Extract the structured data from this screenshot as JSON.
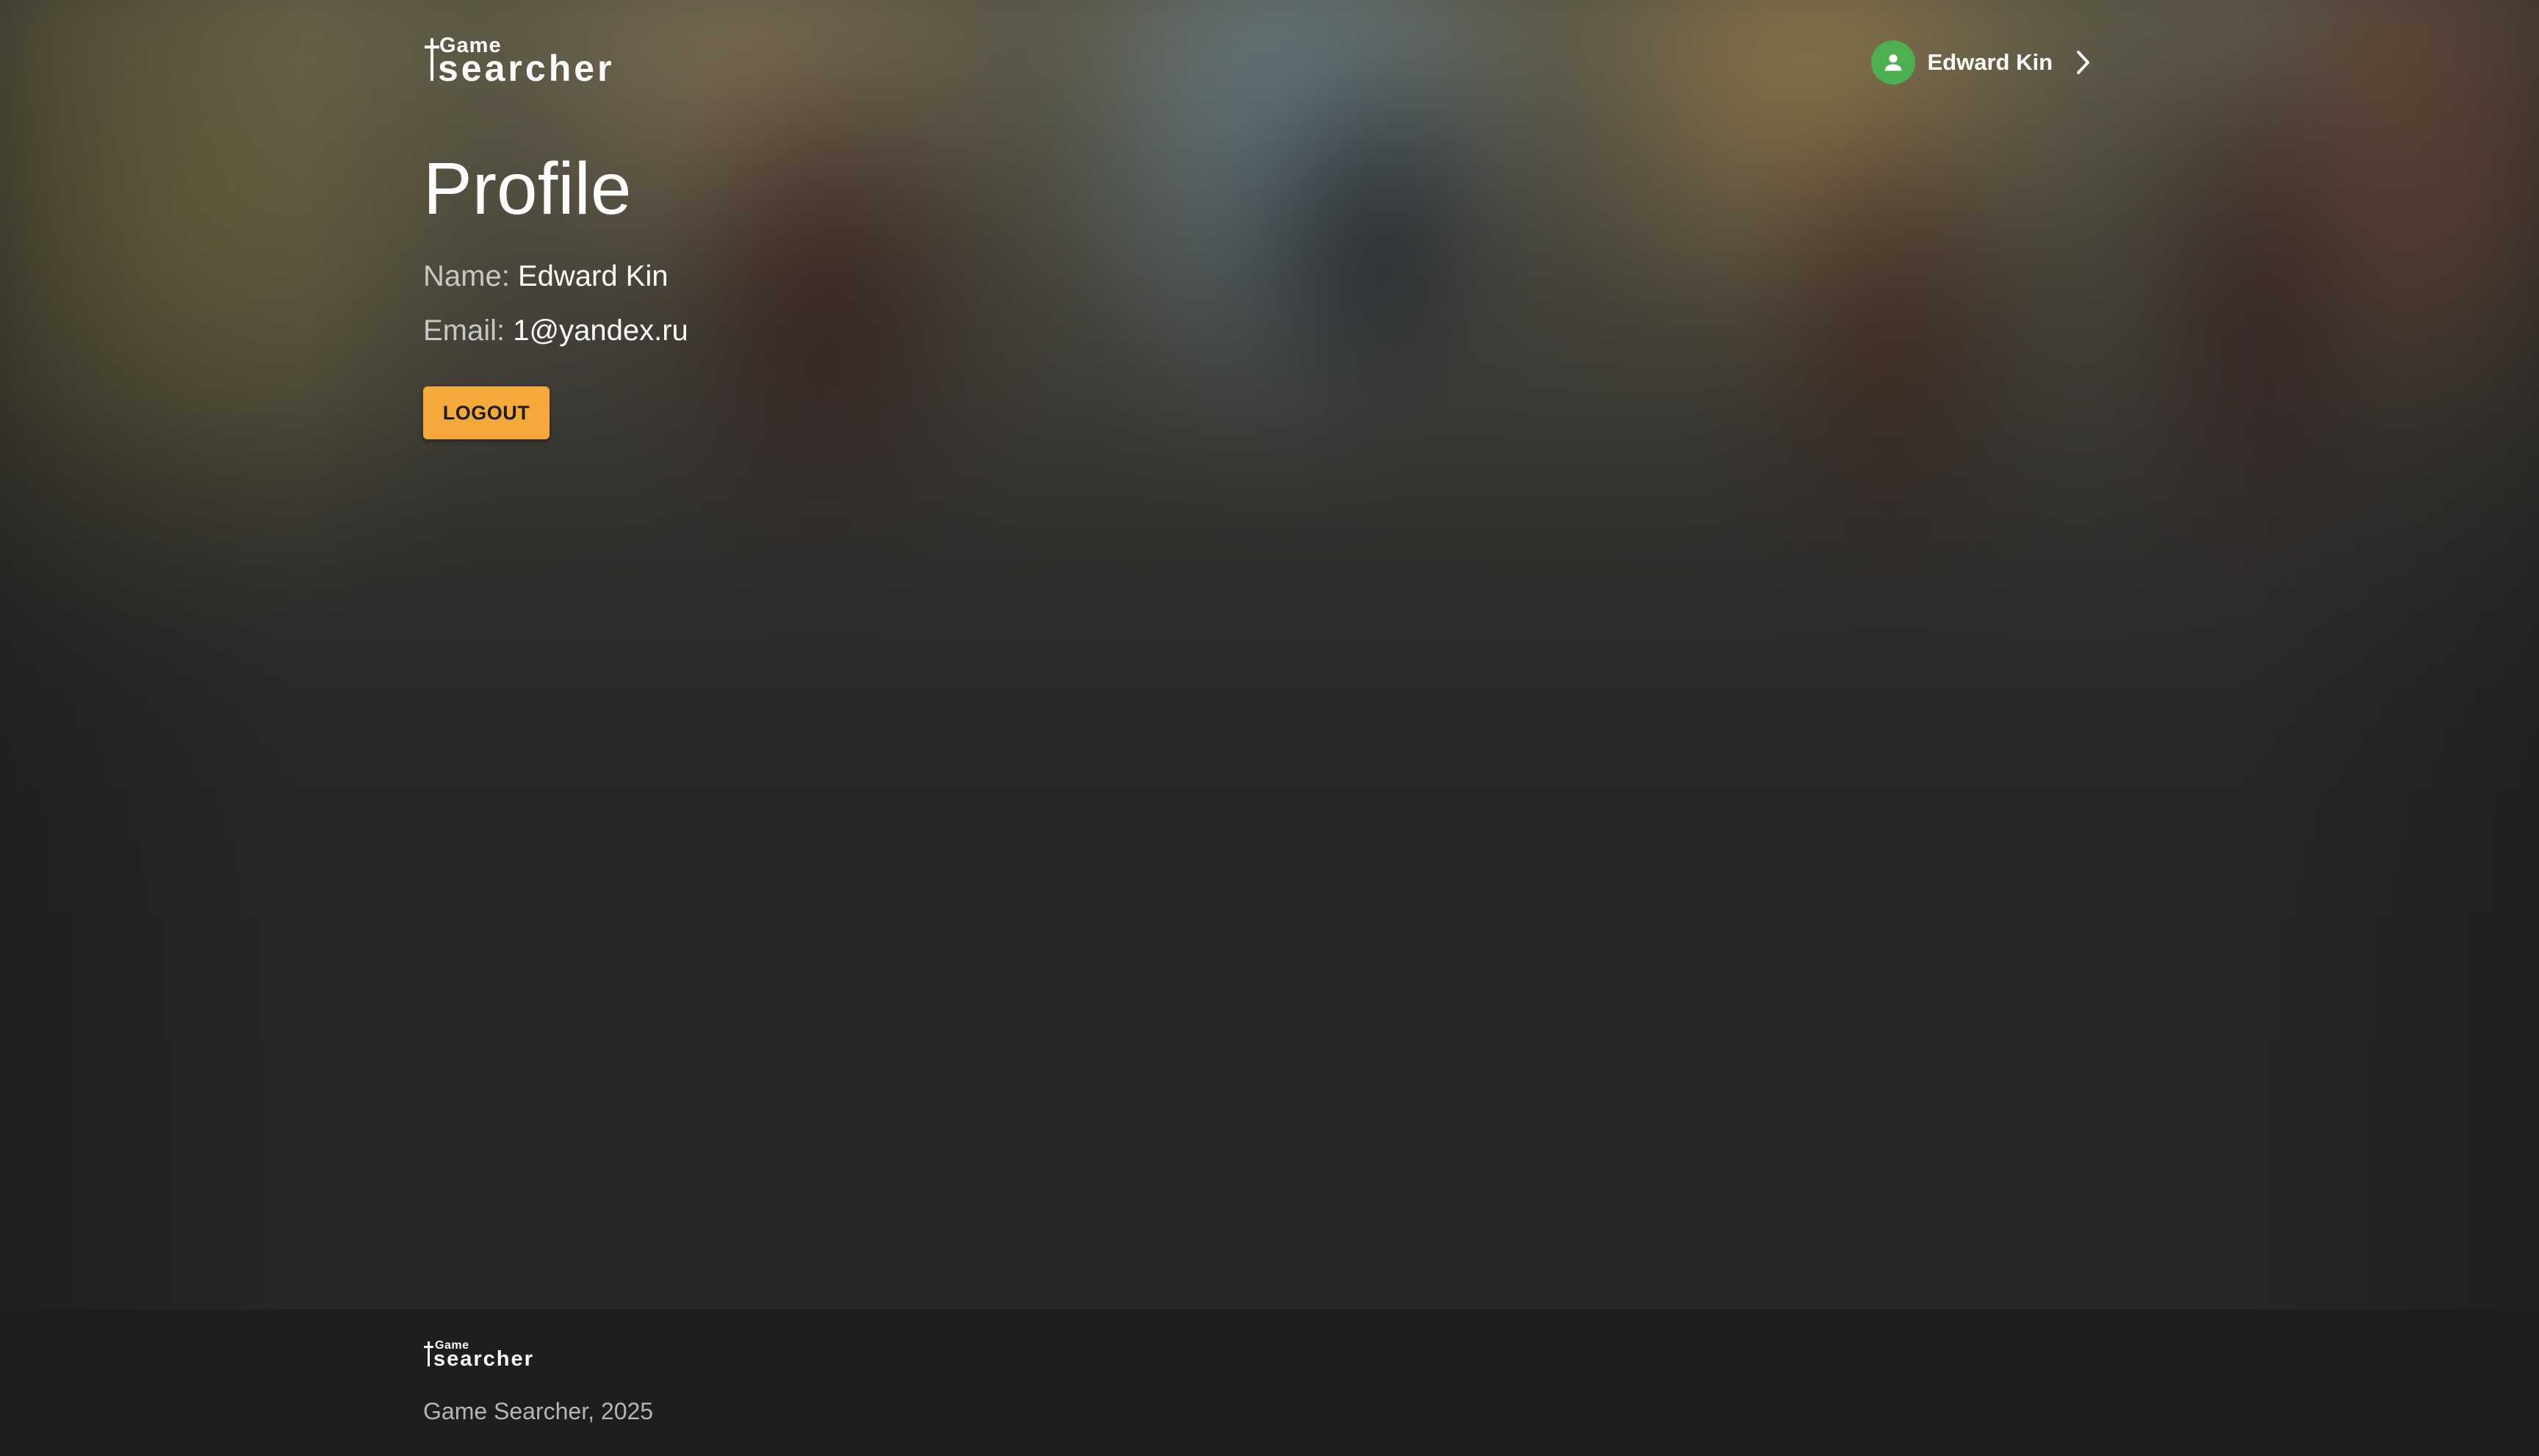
{
  "header": {
    "logo": {
      "small": "Game",
      "big": "searcher"
    },
    "user": {
      "name": "Edward Kin",
      "avatar_color": "#4caf50",
      "avatar_icon": "person-icon",
      "chevron_icon": "chevron-right-icon"
    }
  },
  "profile": {
    "title": "Profile",
    "name_label": "Name:",
    "name_value": "Edward Kin",
    "email_label": "Email:",
    "email_value": "1@yandex.ru",
    "logout_label": "LOGOUT",
    "logout_color": "#f6a93b"
  },
  "footer": {
    "logo": {
      "small": "Game",
      "big": "searcher"
    },
    "copyright": "Game Searcher, 2025"
  }
}
